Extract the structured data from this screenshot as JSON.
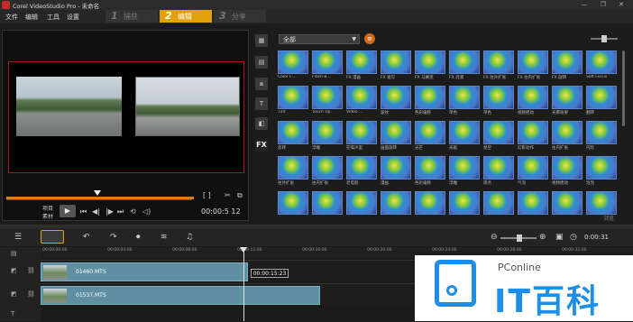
{
  "window": {
    "title": "Corel VideoStudio Pro - 未命名",
    "controls": "— ❐ ✕"
  },
  "menu": [
    "文件",
    "编辑",
    "工具",
    "设置"
  ],
  "tabs": [
    {
      "num": "1",
      "label": "捕获"
    },
    {
      "num": "2",
      "label": "编辑"
    },
    {
      "num": "3",
      "label": "分享"
    }
  ],
  "player": {
    "project_label": "项目",
    "clip_label": "素材",
    "timecode": "00:00:5 12",
    "brackets": "[ ]"
  },
  "library": {
    "filter": "全部",
    "footer": "浏览",
    "effects": [
      "Color F...",
      "Flash B...",
      "FX 漫画",
      "FX 速写",
      "FX 马赛克",
      "FX 涟漪",
      "FX 往外扩张",
      "FX 往内扩张",
      "FX 旋转",
      "Soft Focus",
      "Tint",
      "Touch Up",
      "Video ...",
      "波纹",
      "色彩偏移",
      "单色",
      "单色",
      "视频摇动",
      "光晕效果",
      "翻转",
      "反转",
      "浮雕",
      "在噪声里",
      "画面旋转",
      "光芒",
      "光斑",
      "星空",
      "幻影动作",
      "往内扩张",
      "闪烁",
      "往外扩张",
      "往内扩张",
      "老电影",
      "漫画",
      "色彩偏移",
      "浮雕",
      "雨点",
      "气泡",
      "视频摇动",
      "泡泡",
      "",
      "",
      "",
      "",
      "",
      "",
      "",
      "",
      "",
      ""
    ]
  },
  "timeline": {
    "time": "0:00:31",
    "cursor_tc": "00:00:15:23",
    "ruler_ticks": [
      "00:00:00:00",
      "00:00:04:00",
      "00:00:08:00",
      "00:00:12:00",
      "00:00:16:00",
      "00:00:20:00",
      "00:00:24:00",
      "00:00:28:00",
      "00:00:32:00"
    ],
    "clips": [
      {
        "name": "01460.MTS"
      },
      {
        "name": "01537.MTS"
      }
    ]
  },
  "watermark": {
    "brand": "PConline",
    "text": "IT百科"
  }
}
